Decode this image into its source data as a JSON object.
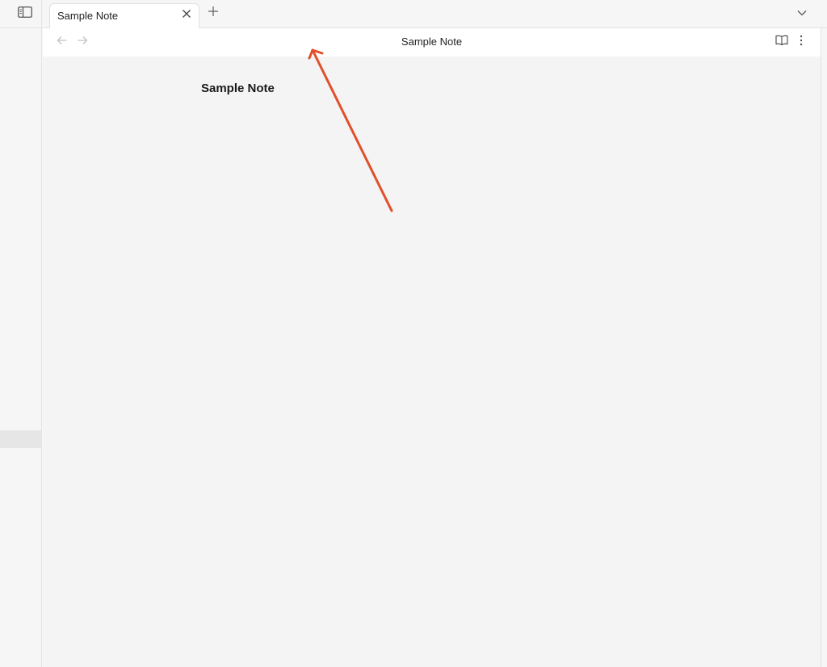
{
  "tab": {
    "title": "Sample Note"
  },
  "header": {
    "title": "Sample Note"
  },
  "note": {
    "title": "Sample Note"
  },
  "icons": {
    "sidebar_toggle": "sidebar-toggle-icon",
    "tab_close": "close-icon",
    "new_tab": "plus-icon",
    "tab_list": "chevron-down-icon",
    "back": "arrow-left-icon",
    "forward": "arrow-right-icon",
    "reading_mode": "book-open-icon",
    "more": "more-vertical-icon"
  },
  "colors": {
    "annotation_arrow": "#e0502a",
    "content_bg": "#f4f4f4",
    "header_bg": "#ffffff"
  }
}
